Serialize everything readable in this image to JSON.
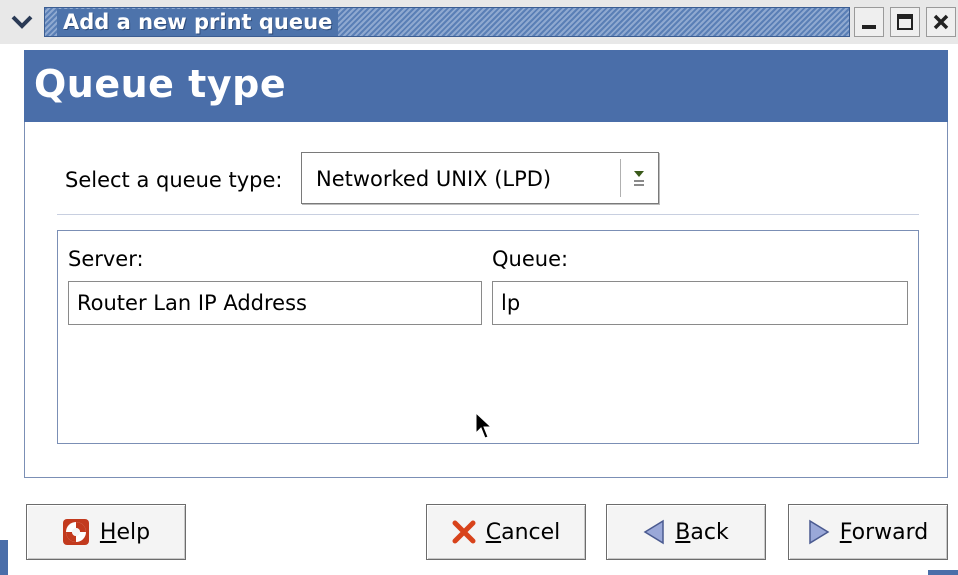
{
  "window": {
    "title": "Add a new print queue",
    "menu_icon": "chevron-down-icon",
    "controls": [
      "minimize-icon",
      "maximize-icon",
      "close-icon"
    ]
  },
  "header": {
    "title": "Queue type"
  },
  "queue_type": {
    "label": "Select a queue type:",
    "selected": "Networked UNIX (LPD)"
  },
  "fields": {
    "server_label": "Server:",
    "server_value": "Router Lan IP Address",
    "queue_label": "Queue:",
    "queue_value": "lp"
  },
  "buttons": {
    "help": "Help",
    "cancel": "Cancel",
    "back": "Back",
    "forward": "Forward"
  },
  "colors": {
    "accent": "#4a6ea9",
    "title_bar": "#5a7fb6",
    "cancel_icon": "#d8431b"
  }
}
